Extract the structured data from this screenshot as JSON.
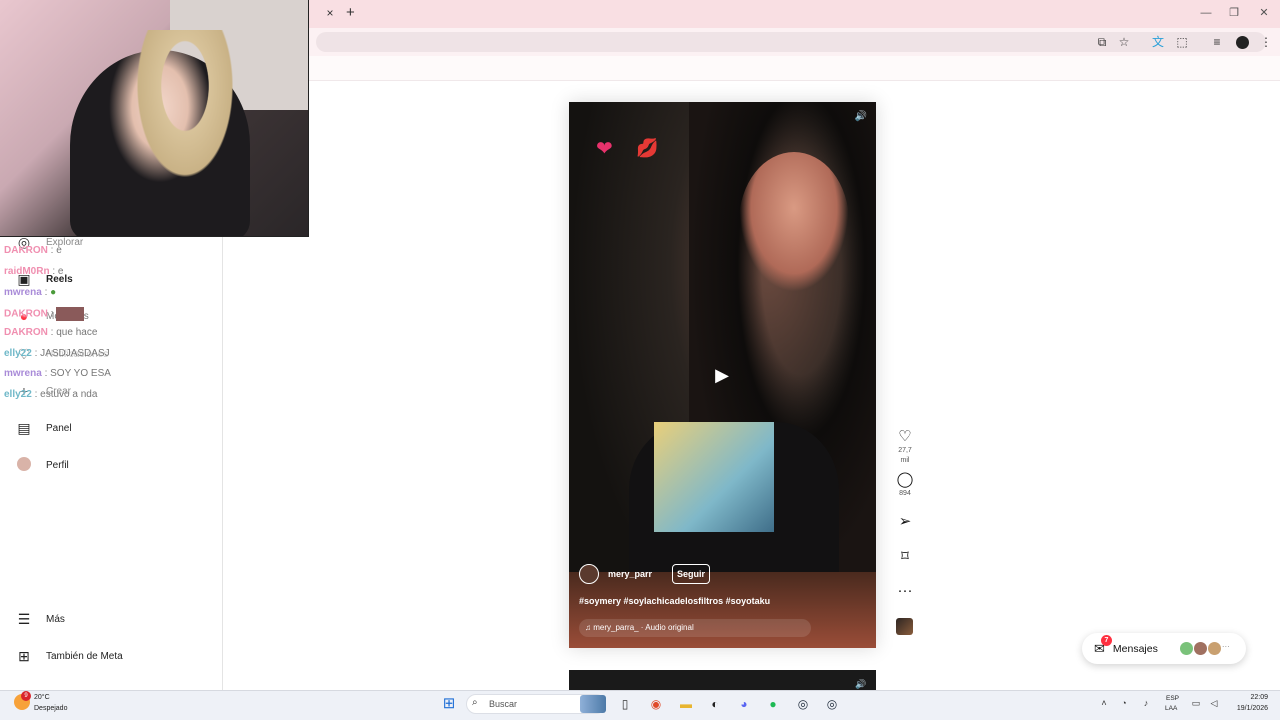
{
  "browser": {
    "tab_close": "×",
    "new_tab": "+",
    "window_controls": [
      "—",
      "❐",
      "✕"
    ]
  },
  "sidebar": {
    "items": [
      {
        "label": "Explorar",
        "icon": "compass-icon"
      },
      {
        "label": "Reels",
        "icon": "reels-icon"
      },
      {
        "label": "Mensajes",
        "icon": "messenger-icon"
      },
      {
        "label": "Notificaciones",
        "icon": "heart-icon"
      },
      {
        "label": "Crear",
        "icon": "plus-icon"
      },
      {
        "label": "Panel",
        "icon": "chart-icon"
      },
      {
        "label": "Perfil",
        "icon": "avatar-icon"
      }
    ],
    "more_label": "Más",
    "meta_label": "También de Meta"
  },
  "chat_overlay": [
    {
      "user": "DAKRON",
      "message": ": e"
    },
    {
      "user": "raidM0Rn",
      "message": ": e"
    },
    {
      "user": "mwrena",
      "message": ":"
    },
    {
      "user": "DAKRON",
      "message": ":"
    },
    {
      "user": "DAKRON",
      "message": ": que hace"
    },
    {
      "user": "elly22",
      "message": ": JASDJASDASJ"
    },
    {
      "user": "mwrena",
      "message": ": SOY YO ESA"
    },
    {
      "user": "elly22",
      "message": ": estuvo a nda"
    }
  ],
  "reel": {
    "username": "mery_parr",
    "follow_label": "Seguir",
    "caption": "#soymery #soylachicadelosfiltros #soyotaku",
    "audio": "mery_parra_ · Audio original"
  },
  "actions": {
    "likes": "27,7 mil",
    "comments": "894"
  },
  "messages": {
    "label": "Mensajes",
    "badge": "7"
  },
  "taskbar": {
    "temperature": "20°C",
    "condition": "Despejado",
    "weather_badge": "9",
    "search_placeholder": "Buscar",
    "lang1": "ESP",
    "lang2": "LAA",
    "time": "22:09",
    "date": "19/1/2026"
  },
  "colors": {
    "tab_strip": "#f9dfe3",
    "like_badge": "#ff3040"
  }
}
